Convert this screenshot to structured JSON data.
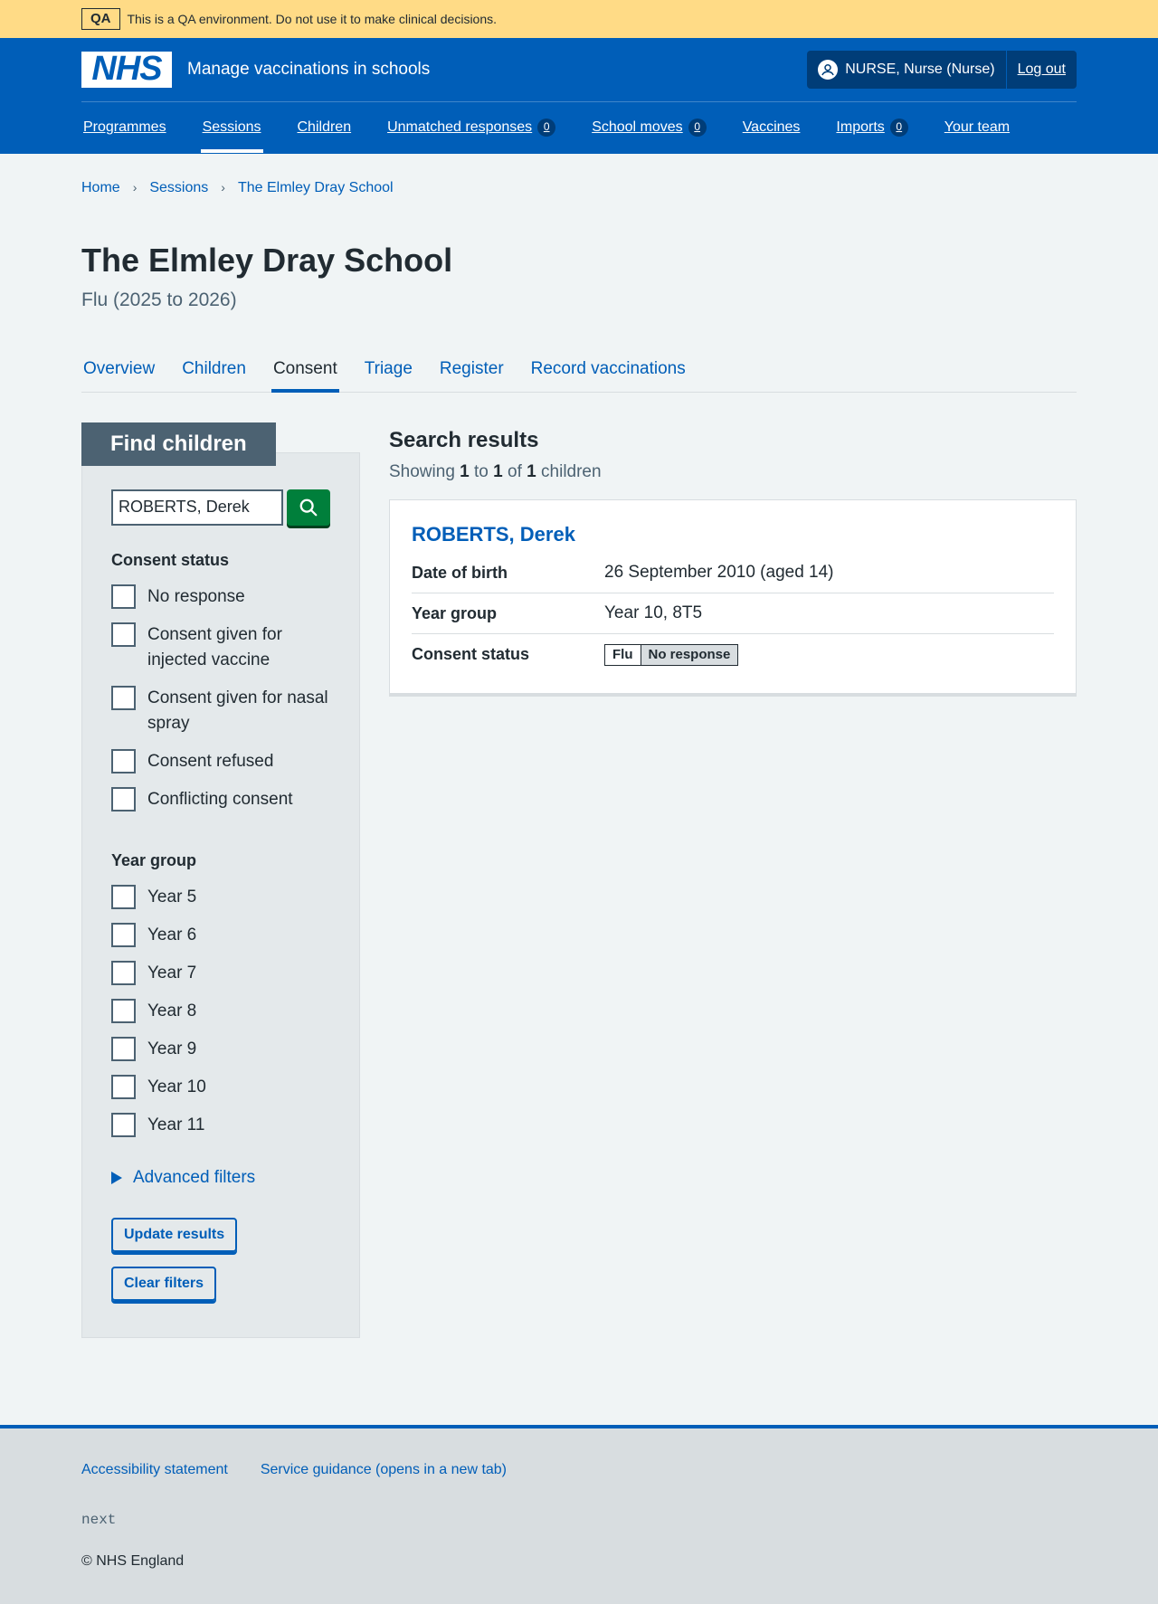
{
  "qa_banner": {
    "tag": "QA",
    "message": "This is a QA environment. Do not use it to make clinical decisions."
  },
  "header": {
    "logo": "NHS",
    "service_name": "Manage vaccinations in schools",
    "account_name": "NURSE, Nurse (Nurse)",
    "logout": "Log out",
    "nav": [
      {
        "label": "Programmes"
      },
      {
        "label": "Sessions"
      },
      {
        "label": "Children"
      },
      {
        "label": "Unmatched responses",
        "count": "0"
      },
      {
        "label": "School moves",
        "count": "0"
      },
      {
        "label": "Vaccines"
      },
      {
        "label": "Imports",
        "count": "0"
      },
      {
        "label": "Your team"
      }
    ]
  },
  "breadcrumbs": [
    "Home",
    "Sessions",
    "The Elmley Dray School"
  ],
  "page": {
    "title": "The Elmley Dray School",
    "caption": "Flu (2025 to 2026)"
  },
  "tabs": [
    "Overview",
    "Children",
    "Consent",
    "Triage",
    "Register",
    "Record vaccinations"
  ],
  "filter": {
    "heading": "Find children",
    "search_value": "ROBERTS, Derek",
    "consent_legend": "Consent status",
    "consent_options": [
      "No response",
      "Consent given for injected vaccine",
      "Consent given for nasal spray",
      "Consent refused",
      "Conflicting consent"
    ],
    "year_legend": "Year group",
    "year_options": [
      "Year 5",
      "Year 6",
      "Year 7",
      "Year 8",
      "Year 9",
      "Year 10",
      "Year 11"
    ],
    "advanced": "Advanced filters",
    "update": "Update results",
    "clear": "Clear filters"
  },
  "results": {
    "title": "Search results",
    "showing": "Showing",
    "from": "1",
    "to_word": "to",
    "to": "1",
    "of_word": "of",
    "total": "1",
    "suffix": "children",
    "child": {
      "name": "ROBERTS, Derek",
      "dob_key": "Date of birth",
      "dob": "26 September 2010 (aged 14)",
      "year_key": "Year group",
      "year": "Year 10, 8T5",
      "consent_key": "Consent status",
      "programme": "Flu",
      "status": "No response"
    }
  },
  "footer": {
    "links": [
      "Accessibility statement",
      "Service guidance (opens in a new tab)"
    ],
    "version": "next",
    "copyright": "© NHS England"
  },
  "colors": {
    "primary": "#005eb8",
    "qa_banner": "#ffdb86",
    "search_button": "#007f3b"
  }
}
